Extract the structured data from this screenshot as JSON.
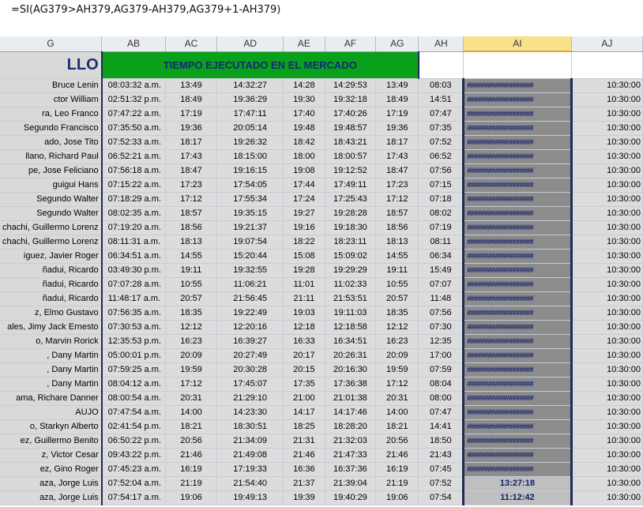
{
  "formula": "=SI(AG379>AH379,AG379-AH379,AG379+1-AH379)",
  "columns": [
    "G",
    "AB",
    "AC",
    "AD",
    "AE",
    "AF",
    "AG",
    "AH",
    "AI",
    "AJ"
  ],
  "title_g": "LLO",
  "title_main": "TIEMPO EJECUTADO EN EL MERCADO",
  "rows": [
    {
      "g": "Bruce Lenin",
      "ab": "08:03:32 a.m.",
      "ac": "13:49",
      "ad": "14:32:27",
      "ae": "14:28",
      "af": "14:29:53",
      "ag": "13:49",
      "ah": "08:03",
      "ai": "###################",
      "aj": "10:30:00"
    },
    {
      "g": "ctor William",
      "ab": "02:51:32 p.m.",
      "ac": "18:49",
      "ad": "19:36:29",
      "ae": "19:30",
      "af": "19:32:18",
      "ag": "18:49",
      "ah": "14:51",
      "ai": "###################",
      "aj": "10:30:00"
    },
    {
      "g": "ra, Leo Franco",
      "ab": "07:47:22 a.m.",
      "ac": "17:19",
      "ad": "17:47:11",
      "ae": "17:40",
      "af": "17:40:26",
      "ag": "17:19",
      "ah": "07:47",
      "ai": "###################",
      "aj": "10:30:00"
    },
    {
      "g": "Segundo Francisco",
      "ab": "07:35:50 a.m.",
      "ac": "19:36",
      "ad": "20:05:14",
      "ae": "19:48",
      "af": "19:48:57",
      "ag": "19:36",
      "ah": "07:35",
      "ai": "###################",
      "aj": "10:30:00"
    },
    {
      "g": "ado, Jose Tito",
      "ab": "07:52:33 a.m.",
      "ac": "18:17",
      "ad": "19:26:32",
      "ae": "18:42",
      "af": "18:43:21",
      "ag": "18:17",
      "ah": "07:52",
      "ai": "###################",
      "aj": "10:30:00"
    },
    {
      "g": "llano, Richard Paul",
      "ab": "06:52:21 a.m.",
      "ac": "17:43",
      "ad": "18:15:00",
      "ae": "18:00",
      "af": "18:00:57",
      "ag": "17:43",
      "ah": "06:52",
      "ai": "###################",
      "aj": "10:30:00"
    },
    {
      "g": "pe, Jose Feliciano",
      "ab": "07:56:18 a.m.",
      "ac": "18:47",
      "ad": "19:16:15",
      "ae": "19:08",
      "af": "19:12:52",
      "ag": "18:47",
      "ah": "07:56",
      "ai": "###################",
      "aj": "10:30:00"
    },
    {
      "g": "guigui Hans",
      "ab": "07:15:22 a.m.",
      "ac": "17:23",
      "ad": "17:54:05",
      "ae": "17:44",
      "af": "17:49:11",
      "ag": "17:23",
      "ah": "07:15",
      "ai": "###################",
      "aj": "10:30:00"
    },
    {
      "g": "Segundo Walter",
      "ab": "07:18:29 a.m.",
      "ac": "17:12",
      "ad": "17:55:34",
      "ae": "17:24",
      "af": "17:25:43",
      "ag": "17:12",
      "ah": "07:18",
      "ai": "###################",
      "aj": "10:30:00"
    },
    {
      "g": "Segundo Walter",
      "ab": "08:02:35 a.m.",
      "ac": "18:57",
      "ad": "19:35:15",
      "ae": "19:27",
      "af": "19:28:28",
      "ag": "18:57",
      "ah": "08:02",
      "ai": "###################",
      "aj": "10:30:00"
    },
    {
      "g": "chachi, Guillermo Lorenz",
      "ab": "07:19:20 a.m.",
      "ac": "18:56",
      "ad": "19:21:37",
      "ae": "19:16",
      "af": "19:18:30",
      "ag": "18:56",
      "ah": "07:19",
      "ai": "###################",
      "aj": "10:30:00"
    },
    {
      "g": "chachi, Guillermo Lorenz",
      "ab": "08:11:31 a.m.",
      "ac": "18:13",
      "ad": "19:07:54",
      "ae": "18:22",
      "af": "18:23:11",
      "ag": "18:13",
      "ah": "08:11",
      "ai": "###################",
      "aj": "10:30:00"
    },
    {
      "g": "iguez, Javier Roger",
      "ab": "06:34:51 a.m.",
      "ac": "14:55",
      "ad": "15:20:44",
      "ae": "15:08",
      "af": "15:09:02",
      "ag": "14:55",
      "ah": "06:34",
      "ai": "###################",
      "aj": "10:30:00"
    },
    {
      "g": "ñadui, Ricardo",
      "ab": "03:49:30 p.m.",
      "ac": "19:11",
      "ad": "19:32:55",
      "ae": "19:28",
      "af": "19:29:29",
      "ag": "19:11",
      "ah": "15:49",
      "ai": "###################",
      "aj": "10:30:00"
    },
    {
      "g": "ñadui, Ricardo",
      "ab": "07:07:28 a.m.",
      "ac": "10:55",
      "ad": "11:06:21",
      "ae": "11:01",
      "af": "11:02:33",
      "ag": "10:55",
      "ah": "07:07",
      "ai": "###################",
      "aj": "10:30:00"
    },
    {
      "g": "ñadui, Ricardo",
      "ab": "11:48:17 a.m.",
      "ac": "20:57",
      "ad": "21:56:45",
      "ae": "21:11",
      "af": "21:53:51",
      "ag": "20:57",
      "ah": "11:48",
      "ai": "###################",
      "aj": "10:30:00"
    },
    {
      "g": "z, Elmo Gustavo",
      "ab": "07:56:35 a.m.",
      "ac": "18:35",
      "ad": "19:22:49",
      "ae": "19:03",
      "af": "19:11:03",
      "ag": "18:35",
      "ah": "07:56",
      "ai": "###################",
      "aj": "10:30:00"
    },
    {
      "g": "ales, Jimy Jack Ernesto",
      "ab": "07:30:53 a.m.",
      "ac": "12:12",
      "ad": "12:20:16",
      "ae": "12:18",
      "af": "12:18:58",
      "ag": "12:12",
      "ah": "07:30",
      "ai": "###################",
      "aj": "10:30:00"
    },
    {
      "g": "o, Marvin Rorick",
      "ab": "12:35:53 p.m.",
      "ac": "16:23",
      "ad": "16:39:27",
      "ae": "16:33",
      "af": "16:34:51",
      "ag": "16:23",
      "ah": "12:35",
      "ai": "###################",
      "aj": "10:30:00"
    },
    {
      "g": ", Dany Martin",
      "ab": "05:00:01 p.m.",
      "ac": "20:09",
      "ad": "20:27:49",
      "ae": "20:17",
      "af": "20:26:31",
      "ag": "20:09",
      "ah": "17:00",
      "ai": "###################",
      "aj": "10:30:00"
    },
    {
      "g": ", Dany Martin",
      "ab": "07:59:25 a.m.",
      "ac": "19:59",
      "ad": "20:30:28",
      "ae": "20:15",
      "af": "20:16:30",
      "ag": "19:59",
      "ah": "07:59",
      "ai": "###################",
      "aj": "10:30:00"
    },
    {
      "g": ", Dany Martin",
      "ab": "08:04:12 a.m.",
      "ac": "17:12",
      "ad": "17:45:07",
      "ae": "17:35",
      "af": "17:36:38",
      "ag": "17:12",
      "ah": "08:04",
      "ai": "###################",
      "aj": "10:30:00"
    },
    {
      "g": "ama, Richare Danner",
      "ab": "08:00:54 a.m.",
      "ac": "20:31",
      "ad": "21:29:10",
      "ae": "21:00",
      "af": "21:01:38",
      "ag": "20:31",
      "ah": "08:00",
      "ai": "###################",
      "aj": "10:30:00"
    },
    {
      "g": "AUJO",
      "ab": "07:47:54 a.m.",
      "ac": "14:00",
      "ad": "14:23:30",
      "ae": "14:17",
      "af": "14:17:46",
      "ag": "14:00",
      "ah": "07:47",
      "ai": "###################",
      "aj": "10:30:00"
    },
    {
      "g": "o, Starkyn Alberto",
      "ab": "02:41:54 p.m.",
      "ac": "18:21",
      "ad": "18:30:51",
      "ae": "18:25",
      "af": "18:28:20",
      "ag": "18:21",
      "ah": "14:41",
      "ai": "###################",
      "aj": "10:30:00"
    },
    {
      "g": "ez, Guillermo Benito",
      "ab": "06:50:22 p.m.",
      "ac": "20:56",
      "ad": "21:34:09",
      "ae": "21:31",
      "af": "21:32:03",
      "ag": "20:56",
      "ah": "18:50",
      "ai": "###################",
      "aj": "10:30:00"
    },
    {
      "g": "z, Victor Cesar",
      "ab": "09:43:22 p.m.",
      "ac": "21:46",
      "ad": "21:49:08",
      "ae": "21:46",
      "af": "21:47:33",
      "ag": "21:46",
      "ah": "21:43",
      "ai": "###################",
      "aj": "10:30:00"
    },
    {
      "g": "ez, Gino Roger",
      "ab": "07:45:23 a.m.",
      "ac": "16:19",
      "ad": "17:19:33",
      "ae": "16:36",
      "af": "16:37:36",
      "ag": "16:19",
      "ah": "07:45",
      "ai": "###################",
      "aj": "10:30:00"
    },
    {
      "g": "aza, Jorge Luis",
      "ab": "07:52:04 a.m.",
      "ac": "21:19",
      "ad": "21:54:40",
      "ae": "21:37",
      "af": "21:39:04",
      "ag": "21:19",
      "ah": "07:52",
      "ai": "13:27:18",
      "aj": "10:30:00"
    },
    {
      "g": "aza, Jorge Luis",
      "ab": "07:54:17 a.m.",
      "ac": "19:06",
      "ad": "19:49:13",
      "ae": "19:39",
      "af": "19:40:29",
      "ag": "19:06",
      "ah": "07:54",
      "ai": "11:12:42",
      "aj": "10:30:00"
    }
  ]
}
